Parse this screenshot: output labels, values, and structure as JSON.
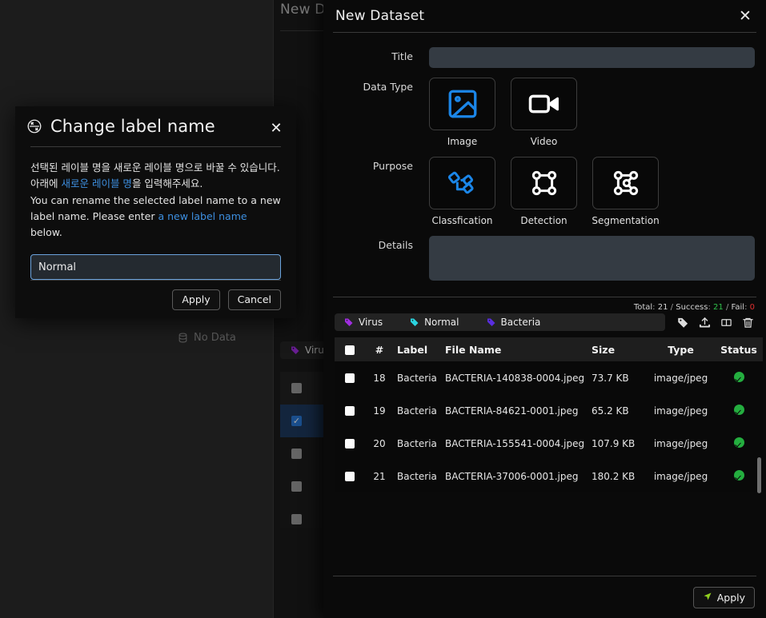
{
  "background": {
    "dialog_title": "New Da",
    "no_data_label": "No Data",
    "tag_chip_label": "Virus",
    "rows": [
      "",
      "",
      "",
      "",
      ""
    ]
  },
  "new_dataset": {
    "title": "New Dataset",
    "close_icon": "close-icon",
    "fields": {
      "title_label": "Title",
      "title_value": "",
      "title_placeholder": "",
      "data_type_label": "Data Type",
      "purpose_label": "Purpose",
      "details_label": "Details",
      "details_value": "",
      "details_placeholder": ""
    },
    "data_types": [
      {
        "label": "Image",
        "icon": "image-icon",
        "selected": true,
        "color": "#1b86e8"
      },
      {
        "label": "Video",
        "icon": "video-camera-icon",
        "selected": false,
        "color": "#ffffff"
      }
    ],
    "purposes": [
      {
        "label": "Classfication",
        "icon": "classification-icon",
        "selected": true,
        "color": "#1b86e8"
      },
      {
        "label": "Detection",
        "icon": "bounding-box-icon",
        "selected": false,
        "color": "#ffffff"
      },
      {
        "label": "Segmentation",
        "icon": "polygon-segmentation-icon",
        "selected": false,
        "color": "#ffffff"
      }
    ],
    "counters": {
      "total_label": "Total",
      "total_value": "21",
      "success_label": "Success",
      "success_value": "21",
      "fail_label": "Fail",
      "fail_value": "0",
      "separator": "/",
      "colon": ":",
      "success_color": "#2fbf4a",
      "fail_color": "#e03030"
    },
    "tags": [
      {
        "label": "Virus",
        "color": "#a02ee0"
      },
      {
        "label": "Normal",
        "color": "#2ad4e0"
      },
      {
        "label": "Bacteria",
        "color": "#5a2ee0"
      }
    ],
    "tools": [
      {
        "name": "tag-icon"
      },
      {
        "name": "upload-icon"
      },
      {
        "name": "columns-view-icon"
      },
      {
        "name": "trash-icon"
      }
    ],
    "table": {
      "columns": [
        "",
        "#",
        "Label",
        "File Name",
        "Size",
        "Type",
        "Status"
      ],
      "rows": [
        {
          "checked": false,
          "num": "18",
          "label": "Bacteria",
          "file": "BACTERIA-140838-0004.jpeg",
          "size": "73.7 KB",
          "type": "image/jpeg",
          "status": "success"
        },
        {
          "checked": false,
          "num": "19",
          "label": "Bacteria",
          "file": "BACTERIA-84621-0001.jpeg",
          "size": "65.2 KB",
          "type": "image/jpeg",
          "status": "success"
        },
        {
          "checked": false,
          "num": "20",
          "label": "Bacteria",
          "file": "BACTERIA-155541-0004.jpeg",
          "size": "107.9 KB",
          "type": "image/jpeg",
          "status": "success"
        },
        {
          "checked": false,
          "num": "21",
          "label": "Bacteria",
          "file": "BACTERIA-37006-0001.jpeg",
          "size": "180.2 KB",
          "type": "image/jpeg",
          "status": "success"
        }
      ]
    },
    "apply_label": "Apply"
  },
  "change_label": {
    "title": "Change label name",
    "swap_icon": "swap-circle-icon",
    "close_icon": "close-icon",
    "desc_ko_line1_a": "선택된 레이블 명을 새로운 레이블 명으로 바꿀 수 있습니다.",
    "desc_ko_line2_a": "아래에 ",
    "desc_ko_line2_hl": "새로운 레이블 명",
    "desc_ko_line2_b": "을 입력해주세요.",
    "desc_en_a": "You can rename the selected label name to a new label name. Please enter ",
    "desc_en_hl": "a new label name",
    "desc_en_b": " below.",
    "input_value": "Normal",
    "input_placeholder": "",
    "apply_label": "Apply",
    "cancel_label": "Cancel",
    "highlight_color": "#3d8fe0"
  }
}
